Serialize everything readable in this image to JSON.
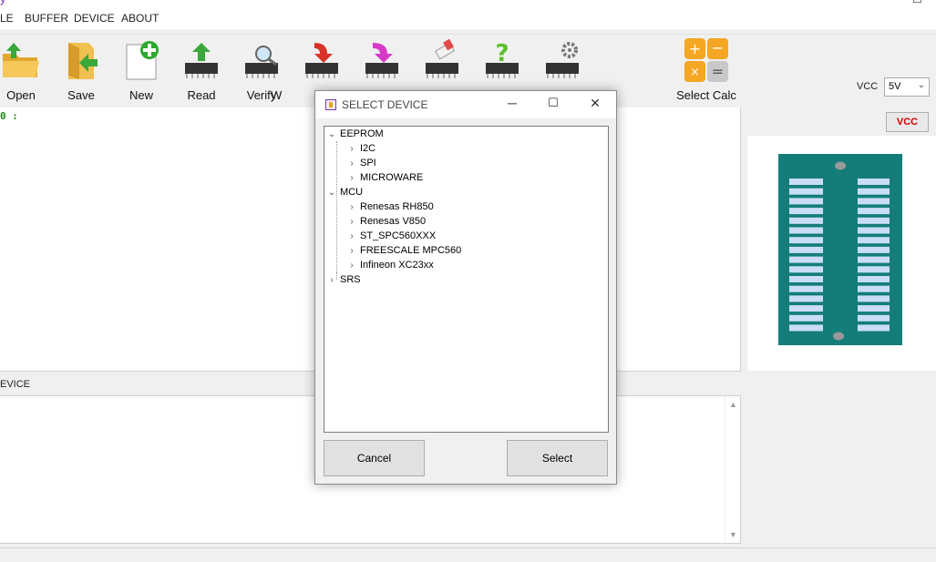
{
  "app": {
    "title_fragment": "y",
    "window_controls": [
      "─",
      "☐"
    ]
  },
  "menu": [
    "LE",
    "BUFFER",
    "DEVICE",
    "ABOUT"
  ],
  "toolbar": {
    "buttons": [
      {
        "label": "Open",
        "icon": "open-folder-icon"
      },
      {
        "label": "Save",
        "icon": "save-folder-icon"
      },
      {
        "label": "New",
        "icon": "new-document-icon"
      },
      {
        "label": "Read",
        "icon": "read-chip-icon"
      },
      {
        "label": "Verify",
        "icon": "verify-chip-icon"
      },
      {
        "label": "W",
        "icon": "write-chip-icon"
      },
      {
        "label": "",
        "icon": "erase-chip-icon"
      },
      {
        "label": "",
        "icon": "blank-check-chip-icon"
      },
      {
        "label": "",
        "icon": "help-chip-icon"
      },
      {
        "label": "",
        "icon": "settings-chip-icon"
      },
      {
        "label": "Select Calc",
        "icon": "calculator-icon"
      }
    ],
    "vcc_label": "VCC",
    "vcc_value": "5V",
    "vcc_button": "VCC"
  },
  "hex": {
    "address": "0 :"
  },
  "device_label": "EVICE",
  "dialog": {
    "title": "SELECT DEVICE",
    "controls": [
      "─",
      "☐",
      "✕"
    ],
    "tree": [
      {
        "label": "EEPROM",
        "expanded": true,
        "children": [
          "I2C",
          "SPI",
          "MICROWARE"
        ]
      },
      {
        "label": "MCU",
        "expanded": true,
        "children": [
          "Renesas RH850",
          "Renesas V850",
          "ST_SPC560XXX",
          "FREESCALE MPC560",
          "Infineon XC23xx"
        ]
      },
      {
        "label": "SRS",
        "expanded": false,
        "children": []
      }
    ],
    "cancel_label": "Cancel",
    "select_label": "Select"
  },
  "colors": {
    "socket": "#147d7a",
    "pin": "#c9def5",
    "accent_green": "#1a8a1a",
    "vcc_red": "#d40000",
    "calc_orange": "#f5a623"
  }
}
